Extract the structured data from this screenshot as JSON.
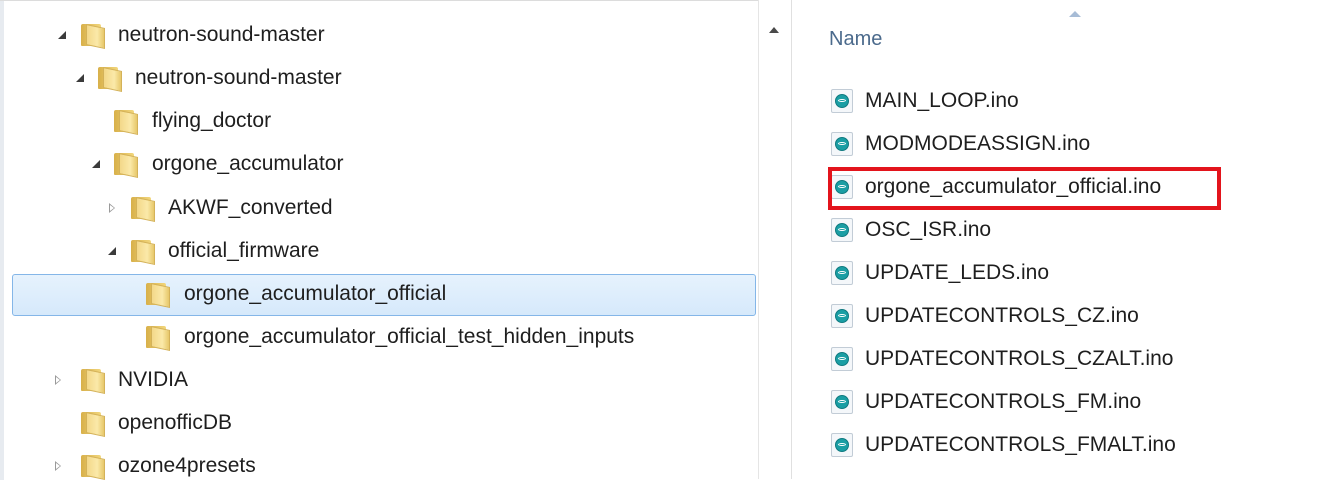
{
  "tree": {
    "items": [
      {
        "label": "neutron-sound-master",
        "expander": "open",
        "icon": "folder-icon",
        "selected": false
      },
      {
        "label": "neutron-sound-master",
        "expander": "open",
        "icon": "folder-icon",
        "selected": false
      },
      {
        "label": "flying_doctor",
        "expander": "none",
        "icon": "folder-icon",
        "selected": false
      },
      {
        "label": "orgone_accumulator",
        "expander": "open",
        "icon": "folder-icon",
        "selected": false
      },
      {
        "label": "AKWF_converted",
        "expander": "closed",
        "icon": "folder-icon",
        "selected": false
      },
      {
        "label": "official_firmware",
        "expander": "open",
        "icon": "folder-icon",
        "selected": false
      },
      {
        "label": "orgone_accumulator_official",
        "expander": "none",
        "icon": "folder-icon",
        "selected": true
      },
      {
        "label": "orgone_accumulator_official_test_hidden_inputs",
        "expander": "none",
        "icon": "folder-icon",
        "selected": false
      },
      {
        "label": "NVIDIA",
        "expander": "closed",
        "icon": "folder-icon",
        "selected": false
      },
      {
        "label": "openofficDB",
        "expander": "none",
        "icon": "folder-icon",
        "selected": false
      },
      {
        "label": "ozone4presets",
        "expander": "closed",
        "icon": "folder-icon",
        "selected": false
      }
    ]
  },
  "file_list": {
    "column_header": "Name",
    "sort_icon": "sort-ascending-icon",
    "files": [
      {
        "label": "MAIN_LOOP.ino",
        "icon": "arduino-file-icon",
        "highlighted": false
      },
      {
        "label": "MODMODEASSIGN.ino",
        "icon": "arduino-file-icon",
        "highlighted": false
      },
      {
        "label": "orgone_accumulator_official.ino",
        "icon": "arduino-file-icon",
        "highlighted": true
      },
      {
        "label": "OSC_ISR.ino",
        "icon": "arduino-file-icon",
        "highlighted": false
      },
      {
        "label": "UPDATE_LEDS.ino",
        "icon": "arduino-file-icon",
        "highlighted": false
      },
      {
        "label": "UPDATECONTROLS_CZ.ino",
        "icon": "arduino-file-icon",
        "highlighted": false
      },
      {
        "label": "UPDATECONTROLS_CZALT.ino",
        "icon": "arduino-file-icon",
        "highlighted": false
      },
      {
        "label": "UPDATECONTROLS_FM.ino",
        "icon": "arduino-file-icon",
        "highlighted": false
      },
      {
        "label": "UPDATECONTROLS_FMALT.ino",
        "icon": "arduino-file-icon",
        "highlighted": false
      }
    ]
  },
  "colors": {
    "selection_fill": "#d6e9fb",
    "selection_border": "#84b6e8",
    "highlight_border": "#e3141c",
    "header_text": "#4b6a8c"
  }
}
